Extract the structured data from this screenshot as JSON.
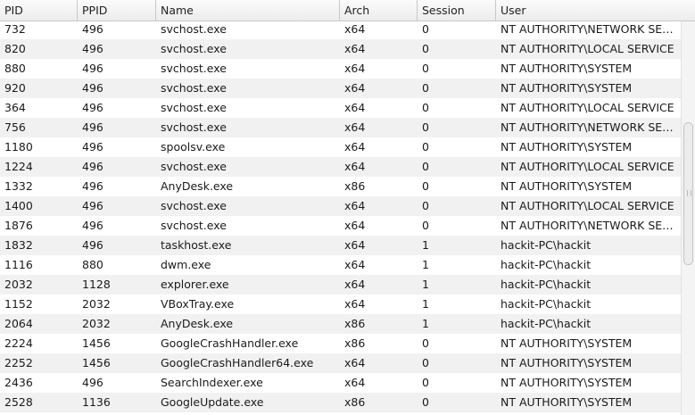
{
  "columns": [
    "PID",
    "PPID",
    "Name",
    "Arch",
    "Session",
    "User"
  ],
  "rows": [
    [
      "732",
      "496",
      "svchost.exe",
      "x64",
      "0",
      "NT AUTHORITY\\NETWORK SERVICE"
    ],
    [
      "820",
      "496",
      "svchost.exe",
      "x64",
      "0",
      "NT AUTHORITY\\LOCAL SERVICE"
    ],
    [
      "880",
      "496",
      "svchost.exe",
      "x64",
      "0",
      "NT AUTHORITY\\SYSTEM"
    ],
    [
      "920",
      "496",
      "svchost.exe",
      "x64",
      "0",
      "NT AUTHORITY\\SYSTEM"
    ],
    [
      "364",
      "496",
      "svchost.exe",
      "x64",
      "0",
      "NT AUTHORITY\\LOCAL SERVICE"
    ],
    [
      "756",
      "496",
      "svchost.exe",
      "x64",
      "0",
      "NT AUTHORITY\\NETWORK SERVICE"
    ],
    [
      "1180",
      "496",
      "spoolsv.exe",
      "x64",
      "0",
      "NT AUTHORITY\\SYSTEM"
    ],
    [
      "1224",
      "496",
      "svchost.exe",
      "x64",
      "0",
      "NT AUTHORITY\\LOCAL SERVICE"
    ],
    [
      "1332",
      "496",
      "AnyDesk.exe",
      "x86",
      "0",
      "NT AUTHORITY\\SYSTEM"
    ],
    [
      "1400",
      "496",
      "svchost.exe",
      "x64",
      "0",
      "NT AUTHORITY\\LOCAL SERVICE"
    ],
    [
      "1876",
      "496",
      "svchost.exe",
      "x64",
      "0",
      "NT AUTHORITY\\NETWORK SERVICE"
    ],
    [
      "1832",
      "496",
      "taskhost.exe",
      "x64",
      "1",
      "hackit-PC\\hackit"
    ],
    [
      "1116",
      "880",
      "dwm.exe",
      "x64",
      "1",
      "hackit-PC\\hackit"
    ],
    [
      "2032",
      "1128",
      "explorer.exe",
      "x64",
      "1",
      "hackit-PC\\hackit"
    ],
    [
      "1152",
      "2032",
      "VBoxTray.exe",
      "x64",
      "1",
      "hackit-PC\\hackit"
    ],
    [
      "2064",
      "2032",
      "AnyDesk.exe",
      "x86",
      "1",
      "hackit-PC\\hackit"
    ],
    [
      "2224",
      "1456",
      "GoogleCrashHandler.exe",
      "x86",
      "0",
      "NT AUTHORITY\\SYSTEM"
    ],
    [
      "2252",
      "1456",
      "GoogleCrashHandler64.exe",
      "x64",
      "0",
      "NT AUTHORITY\\SYSTEM"
    ],
    [
      "2436",
      "496",
      "SearchIndexer.exe",
      "x64",
      "0",
      "NT AUTHORITY\\SYSTEM"
    ],
    [
      "2528",
      "1136",
      "GoogleUpdate.exe",
      "x86",
      "0",
      "NT AUTHORITY\\SYSTEM"
    ]
  ]
}
